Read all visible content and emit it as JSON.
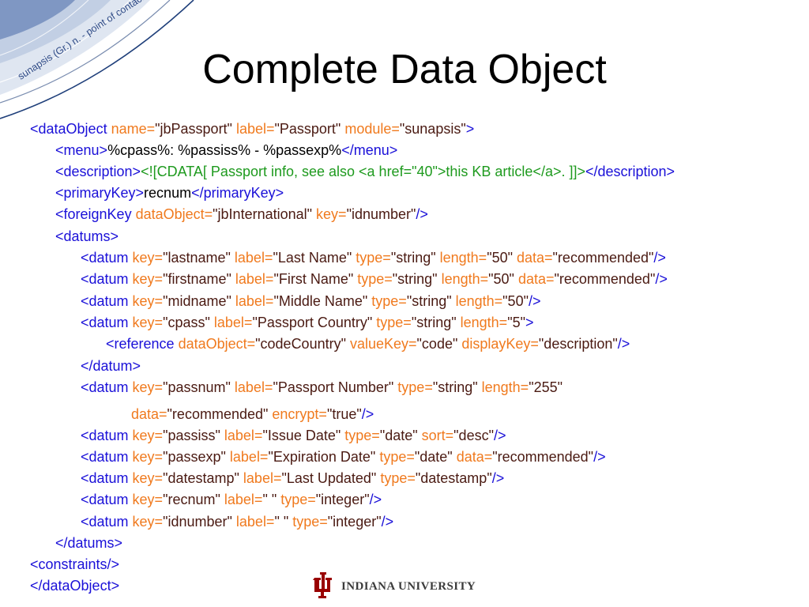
{
  "slide": {
    "corner_caption": "sunapsis (Gr.) n. - point of contact",
    "title": "Complete Data Object"
  },
  "colors": {
    "tag": "#1a10d8",
    "attribute_name": "#f07a1e",
    "attribute_value": "#4a1a12",
    "text": "#000000",
    "cdata": "#1e9a1e",
    "corner_art": "#1f3f7a",
    "logo_red": "#990000"
  },
  "code_lines": [
    [
      [
        "tag",
        "<dataObject "
      ],
      [
        "attr",
        "name="
      ],
      [
        "val",
        "\"jbPassport\" "
      ],
      [
        "attr",
        "label="
      ],
      [
        "val",
        "\"Passport\" "
      ],
      [
        "attr",
        "module="
      ],
      [
        "val",
        "\"sunapsis\""
      ],
      [
        "tag",
        ">"
      ]
    ],
    [
      [
        "tag",
        "<menu>"
      ],
      [
        "text",
        "%cpass%: %passiss% - %passexp%"
      ],
      [
        "tag",
        "</menu>"
      ]
    ],
    [
      [
        "tag",
        "<description>"
      ],
      [
        "cdata",
        "<![CDATA[ Passport info, see also <a href=\"40\">this KB article</a>. ]]>"
      ],
      [
        "tag",
        "</description>"
      ]
    ],
    [
      [
        "tag",
        "<primaryKey>"
      ],
      [
        "text",
        "recnum"
      ],
      [
        "tag",
        "</primaryKey>"
      ]
    ],
    [
      [
        "tag",
        "<foreignKey "
      ],
      [
        "attr",
        "dataObject="
      ],
      [
        "val",
        "\"jbInternational\" "
      ],
      [
        "attr",
        "key="
      ],
      [
        "val",
        "\"idnumber\""
      ],
      [
        "tag",
        "/>"
      ]
    ],
    [
      [
        "tag",
        "<datums>"
      ]
    ],
    [
      [
        "tag",
        "<datum "
      ],
      [
        "attr",
        "key="
      ],
      [
        "val",
        "\"lastname\" "
      ],
      [
        "attr",
        "label="
      ],
      [
        "val",
        "\"Last Name\" "
      ],
      [
        "attr",
        "type="
      ],
      [
        "val",
        "\"string\" "
      ],
      [
        "attr",
        "length="
      ],
      [
        "val",
        "\"50\" "
      ],
      [
        "attr",
        "data="
      ],
      [
        "val",
        "\"recommended\""
      ],
      [
        "tag",
        "/>"
      ]
    ],
    [
      [
        "tag",
        "<datum "
      ],
      [
        "attr",
        "key="
      ],
      [
        "val",
        "\"firstname\" "
      ],
      [
        "attr",
        "label="
      ],
      [
        "val",
        "\"First Name\" "
      ],
      [
        "attr",
        "type="
      ],
      [
        "val",
        "\"string\" "
      ],
      [
        "attr",
        "length="
      ],
      [
        "val",
        "\"50\" "
      ],
      [
        "attr",
        "data="
      ],
      [
        "val",
        "\"recommended\""
      ],
      [
        "tag",
        "/>"
      ]
    ],
    [
      [
        "tag",
        "<datum "
      ],
      [
        "attr",
        "key="
      ],
      [
        "val",
        "\"midname\" "
      ],
      [
        "attr",
        "label="
      ],
      [
        "val",
        "\"Middle Name\" "
      ],
      [
        "attr",
        "type="
      ],
      [
        "val",
        "\"string\" "
      ],
      [
        "attr",
        "length="
      ],
      [
        "val",
        "\"50\""
      ],
      [
        "tag",
        "/>"
      ]
    ],
    [
      [
        "tag",
        "<datum "
      ],
      [
        "attr",
        "key="
      ],
      [
        "val",
        "\"cpass\" "
      ],
      [
        "attr",
        "label="
      ],
      [
        "val",
        "\"Passport Country\" "
      ],
      [
        "attr",
        "type="
      ],
      [
        "val",
        "\"string\" "
      ],
      [
        "attr",
        "length="
      ],
      [
        "val",
        "\"5\""
      ],
      [
        "tag",
        ">"
      ]
    ],
    [
      [
        "tag",
        "<reference "
      ],
      [
        "attr",
        "dataObject="
      ],
      [
        "val",
        "\"codeCountry\" "
      ],
      [
        "attr",
        "valueKey="
      ],
      [
        "val",
        "\"code\" "
      ],
      [
        "attr",
        "displayKey="
      ],
      [
        "val",
        "\"description\""
      ],
      [
        "tag",
        "/>"
      ]
    ],
    [
      [
        "tag",
        "</datum>"
      ]
    ],
    [
      [
        "tag",
        "<datum "
      ],
      [
        "attr",
        "key="
      ],
      [
        "val",
        "\"passnum\" "
      ],
      [
        "attr",
        "label="
      ],
      [
        "val",
        "\"Passport Number\" "
      ],
      [
        "attr",
        "type="
      ],
      [
        "val",
        "\"string\" "
      ],
      [
        "attr",
        "length="
      ],
      [
        "val",
        "\"255\""
      ]
    ],
    [
      [
        "attr",
        "data="
      ],
      [
        "val",
        "\"recommended\" "
      ],
      [
        "attr",
        "encrypt="
      ],
      [
        "val",
        "\"true\""
      ],
      [
        "tag",
        "/>"
      ]
    ],
    [
      [
        "tag",
        "<datum "
      ],
      [
        "attr",
        "key="
      ],
      [
        "val",
        "\"passiss\" "
      ],
      [
        "attr",
        "label="
      ],
      [
        "val",
        "\"Issue Date\" "
      ],
      [
        "attr",
        "type="
      ],
      [
        "val",
        "\"date\" "
      ],
      [
        "attr",
        "sort="
      ],
      [
        "val",
        "\"desc\""
      ],
      [
        "tag",
        "/>"
      ]
    ],
    [
      [
        "tag",
        "<datum "
      ],
      [
        "attr",
        "key="
      ],
      [
        "val",
        "\"passexp\" "
      ],
      [
        "attr",
        "label="
      ],
      [
        "val",
        "\"Expiration Date\" "
      ],
      [
        "attr",
        "type="
      ],
      [
        "val",
        "\"date\" "
      ],
      [
        "attr",
        "data="
      ],
      [
        "val",
        "\"recommended\""
      ],
      [
        "tag",
        "/>"
      ]
    ],
    [
      [
        "tag",
        "<datum "
      ],
      [
        "attr",
        "key="
      ],
      [
        "val",
        "\"datestamp\" "
      ],
      [
        "attr",
        "label="
      ],
      [
        "val",
        "\"Last Updated\" "
      ],
      [
        "attr",
        "type="
      ],
      [
        "val",
        "\"datestamp\""
      ],
      [
        "tag",
        "/>"
      ]
    ],
    [
      [
        "tag",
        "<datum "
      ],
      [
        "attr",
        "key="
      ],
      [
        "val",
        "\"recnum\" "
      ],
      [
        "attr",
        "label="
      ],
      [
        "val",
        "\" \" "
      ],
      [
        "attr",
        "type="
      ],
      [
        "val",
        "\"integer\""
      ],
      [
        "tag",
        "/>"
      ]
    ],
    [
      [
        "tag",
        "<datum "
      ],
      [
        "attr",
        "key="
      ],
      [
        "val",
        "\"idnumber\" "
      ],
      [
        "attr",
        "label="
      ],
      [
        "val",
        "\" \" "
      ],
      [
        "attr",
        "type="
      ],
      [
        "val",
        "\"integer\""
      ],
      [
        "tag",
        "/>"
      ]
    ],
    [
      [
        "tag",
        "</datums>"
      ]
    ],
    [
      [
        "tag",
        "<constraints/>"
      ]
    ],
    [
      [
        "tag",
        "</dataObject>"
      ]
    ]
  ],
  "footer": {
    "logo_text": "INDIANA UNIVERSITY"
  }
}
